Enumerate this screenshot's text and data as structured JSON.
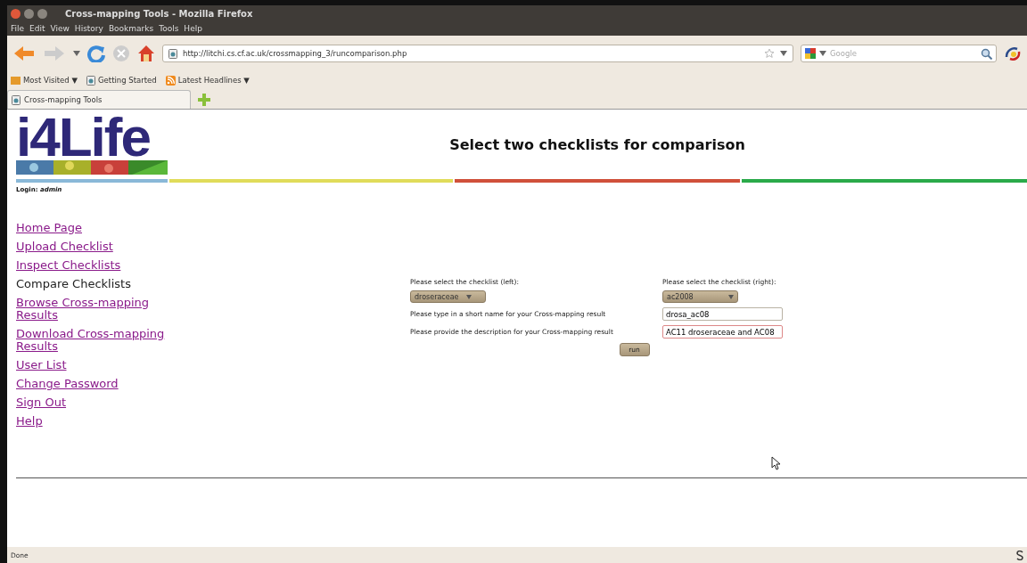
{
  "window": {
    "title": "Cross-mapping Tools - Mozilla Firefox"
  },
  "menu": [
    "File",
    "Edit",
    "View",
    "History",
    "Bookmarks",
    "Tools",
    "Help"
  ],
  "address": {
    "value": "http://litchi.cs.cf.ac.uk/crossmapping_3/runcomparison.php"
  },
  "search": {
    "placeholder": "Google"
  },
  "bookmarks": [
    {
      "label": "Most Visited ▼",
      "kind": "folder"
    },
    {
      "label": "Getting Started",
      "kind": "page"
    },
    {
      "label": "Latest Headlines ▼",
      "kind": "feed"
    }
  ],
  "tabs": [
    {
      "label": "Cross-mapping Tools",
      "selected": true
    }
  ],
  "page": {
    "logo": "i4Life",
    "heading": "Select two checklists for comparison",
    "login_label": "Login:",
    "login_user": "admin",
    "nav": [
      {
        "label": "Home Page",
        "selected": false
      },
      {
        "label": "Upload Checklist",
        "selected": false
      },
      {
        "label": "Inspect Checklists",
        "selected": false
      },
      {
        "label": "Compare Checklists",
        "selected": true
      },
      {
        "label": "Browse Cross-mapping Results",
        "selected": false
      },
      {
        "label": "Download Cross-mapping Results",
        "selected": false
      },
      {
        "label": "User List",
        "selected": false
      },
      {
        "label": "Change Password",
        "selected": false
      },
      {
        "label": "Sign Out",
        "selected": false
      },
      {
        "label": "Help",
        "selected": false
      }
    ],
    "form": {
      "left_label": "Please select the checklist (left):",
      "left_value": "droseraceae",
      "right_label": "Please select the checklist (right):",
      "right_value": "ac2008",
      "name_label": "Please type in a short name for your Cross-mapping result",
      "name_value": "drosa_ac08",
      "desc_label": "Please provide the description for your Cross-mapping result",
      "desc_value": "AC11 droseraceae and AC08",
      "submit": "run"
    }
  },
  "status_bar": {
    "text": "Done"
  }
}
